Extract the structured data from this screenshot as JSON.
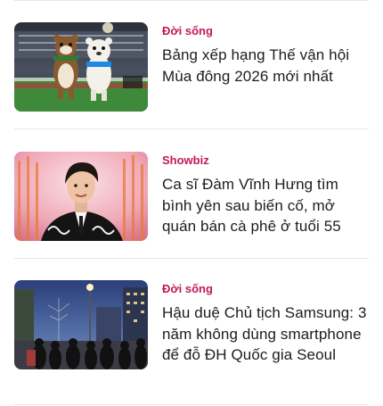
{
  "articles": [
    {
      "category": "Đời sống",
      "title": "Bảng xếp hạng Thế vận hội Mùa đông 2026 mới nhất",
      "thumbnail": "olympic-mascots-stadium-image"
    },
    {
      "category": "Showbiz",
      "title": "Ca sĩ Đàm Vĩnh Hưng tìm bình yên sau biến cố, mở quán bán cà phê ở tuổi 55",
      "thumbnail": "singer-portrait-image"
    },
    {
      "category": "Đời sống",
      "title": "Hậu duệ Chủ tịch Samsung: 3 năm không dùng smartphone để đỗ ĐH Quốc gia Seoul",
      "thumbnail": "night-street-crowd-image"
    }
  ],
  "colors": {
    "category": "#c2185b",
    "title": "#1c1c1c",
    "divider": "#e6e6e6"
  }
}
